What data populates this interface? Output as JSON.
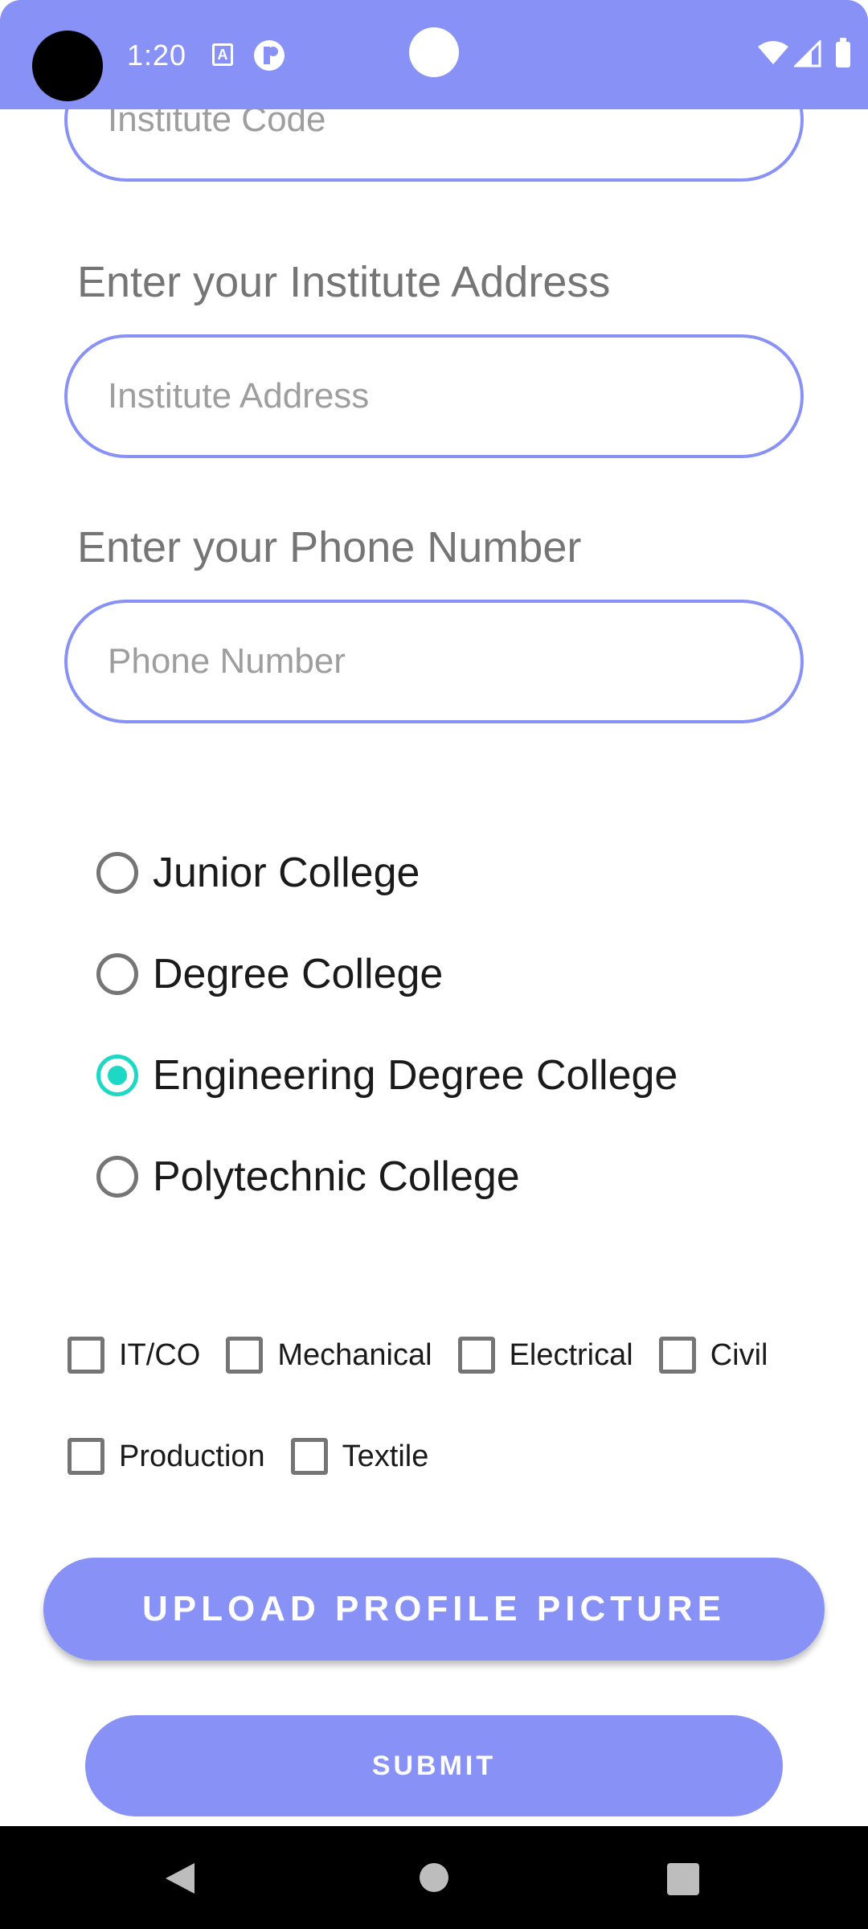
{
  "status_bar": {
    "time": "1:20",
    "icons": [
      "text-icon",
      "p-icon",
      "wifi-icon",
      "signal-icon",
      "battery-icon"
    ],
    "background": "#8891f5"
  },
  "form": {
    "institute_code": {
      "placeholder": "Institute Code"
    },
    "institute_address": {
      "label": "Enter your Institute Address",
      "placeholder": "Institute Address"
    },
    "phone_number": {
      "label": "Enter your Phone Number",
      "placeholder": "Phone Number"
    },
    "college_types": [
      {
        "label": "Junior College",
        "selected": false
      },
      {
        "label": "Degree College",
        "selected": false
      },
      {
        "label": "Engineering Degree College",
        "selected": true
      },
      {
        "label": "Polytechnic College",
        "selected": false
      }
    ],
    "branches": [
      {
        "label": "IT/CO",
        "checked": false
      },
      {
        "label": "Mechanical",
        "checked": false
      },
      {
        "label": "Electrical",
        "checked": false
      },
      {
        "label": "Civil",
        "checked": false
      },
      {
        "label": "Production",
        "checked": false
      },
      {
        "label": "Textile",
        "checked": false
      }
    ],
    "upload_button": "UPLOAD PROFILE PICTURE",
    "submit_button": "SUBMIT"
  },
  "colors": {
    "accent": "#8891f5",
    "radio_selected": "#1ed8c6"
  },
  "nav_bar": {
    "icons": [
      "back-icon",
      "home-icon",
      "recents-icon"
    ]
  }
}
